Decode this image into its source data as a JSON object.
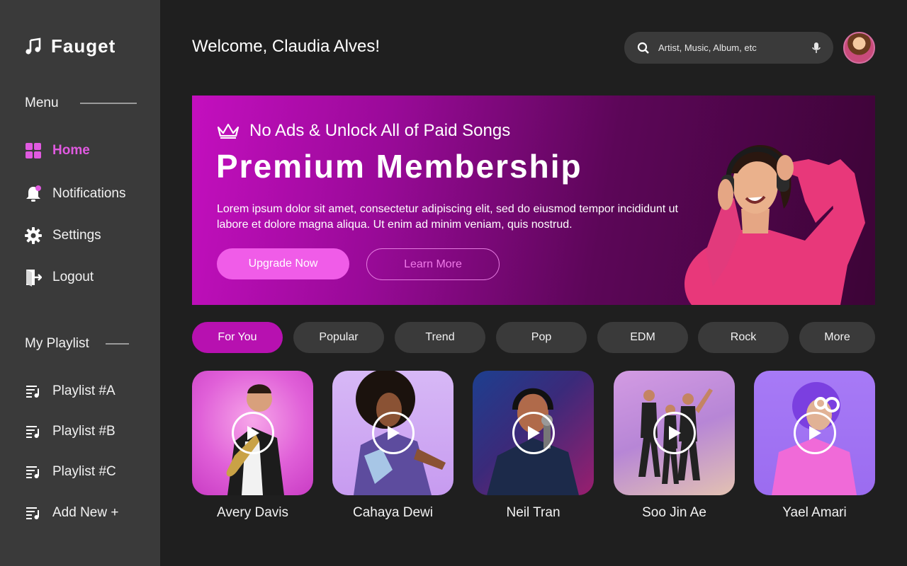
{
  "brand": {
    "name": "Fauget"
  },
  "menu": {
    "heading": "Menu",
    "items": [
      {
        "label": "Home",
        "icon": "grid-icon",
        "active": true
      },
      {
        "label": "Notifications",
        "icon": "bell-icon"
      },
      {
        "label": "Settings",
        "icon": "gear-icon"
      },
      {
        "label": "Logout",
        "icon": "logout-icon"
      }
    ]
  },
  "playlist": {
    "heading": "My Playlist",
    "items": [
      {
        "label": "Playlist #A"
      },
      {
        "label": "Playlist #B"
      },
      {
        "label": "Playlist #C"
      },
      {
        "label": "Add New +"
      }
    ]
  },
  "header": {
    "welcome": "Welcome, Claudia Alves!",
    "search_placeholder": "Artist, Music, Album, etc"
  },
  "banner": {
    "tagline": "No Ads & Unlock All of Paid Songs",
    "title": "Premium Membership",
    "description": "Lorem ipsum dolor sit amet, consectetur adipiscing elit, sed do eiusmod tempor incididunt ut labore et dolore magna aliqua. Ut enim ad minim veniam, quis nostrud.",
    "upgrade_label": "Upgrade Now",
    "learn_label": "Learn More"
  },
  "tabs": [
    "For You",
    "Popular",
    "Trend",
    "Pop",
    "EDM",
    "Rock",
    "More"
  ],
  "artists": [
    {
      "name": "Avery Davis"
    },
    {
      "name": "Cahaya Dewi"
    },
    {
      "name": "Neil Tran"
    },
    {
      "name": "Soo Jin Ae"
    },
    {
      "name": "Yael Amari"
    }
  ],
  "colors": {
    "accent": "#e05ae0",
    "tab_active": "#b711b0",
    "sidebar": "#3a3a3a",
    "background": "#1f1f1f"
  }
}
